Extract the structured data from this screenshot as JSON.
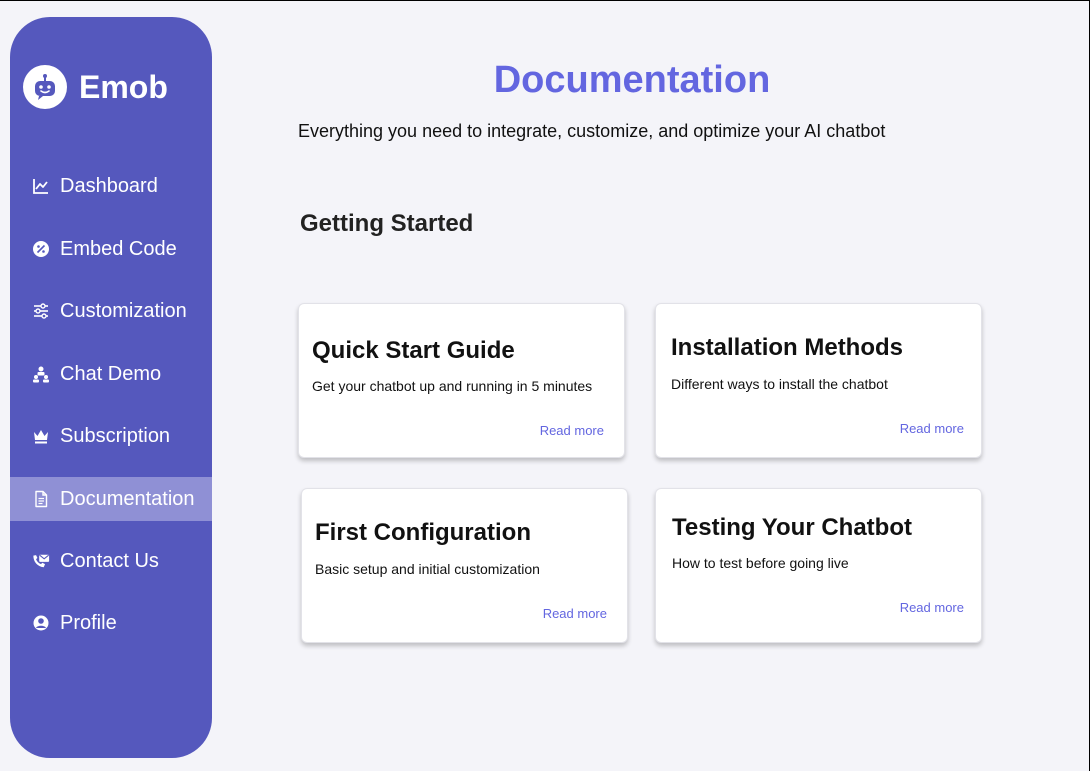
{
  "brand": {
    "name": "Emob",
    "logo_icon": "robot-icon",
    "color": "#5558bd"
  },
  "sidebar": {
    "items": [
      {
        "label": "Dashboard",
        "icon": "chart-line-icon",
        "active": false
      },
      {
        "label": "Embed Code",
        "icon": "percent-badge-icon",
        "active": false
      },
      {
        "label": "Customization",
        "icon": "sliders-icon",
        "active": false
      },
      {
        "label": "Chat Demo",
        "icon": "people-icon",
        "active": false
      },
      {
        "label": "Subscription",
        "icon": "crown-icon",
        "active": false
      },
      {
        "label": "Documentation",
        "icon": "document-icon",
        "active": true
      },
      {
        "label": "Contact Us",
        "icon": "phone-envelope-icon",
        "active": false
      },
      {
        "label": "Profile",
        "icon": "user-circle-icon",
        "active": false
      }
    ]
  },
  "main": {
    "title": "Documentation",
    "subtitle": "Everything you need to integrate, customize, and optimize your AI chatbot",
    "section_title": "Getting Started",
    "cards": [
      {
        "title": "Quick Start Guide",
        "description": "Get your chatbot up and running in 5 minutes",
        "link": "Read more"
      },
      {
        "title": "Installation Methods",
        "description": "Different ways to install the chatbot",
        "link": "Read more"
      },
      {
        "title": "First Configuration",
        "description": "Basic setup and initial customization",
        "link": "Read more"
      },
      {
        "title": "Testing Your Chatbot",
        "description": "How to test before going live",
        "link": "Read more"
      }
    ]
  },
  "colors": {
    "accent": "#6366e0",
    "sidebar_bg": "#5558bd",
    "sidebar_active": "#8f90d5",
    "page_bg": "#f4f4f9"
  }
}
